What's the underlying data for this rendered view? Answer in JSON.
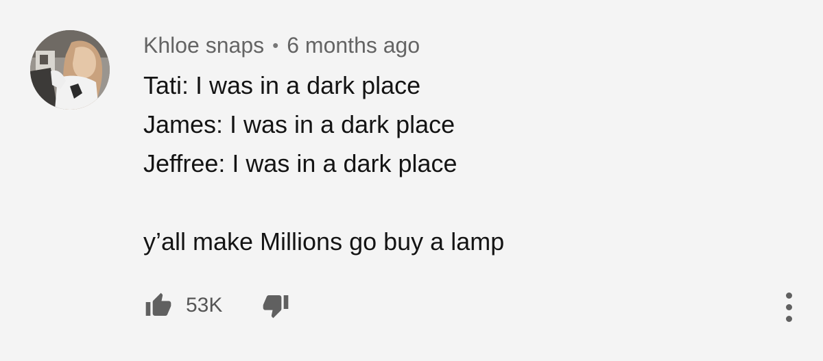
{
  "comment": {
    "author": "Khloe snaps",
    "separator": "•",
    "timestamp": "6 months ago",
    "lines": [
      "Tati: I was in a dark place",
      "James: I was in a dark place",
      "Jeffree: I was in a dark place",
      "",
      "y’all make Millions go buy a lamp"
    ],
    "like_count": "53K"
  },
  "icons": {
    "like": "thumbs-up-icon",
    "dislike": "thumbs-down-icon",
    "more": "more-vertical-icon",
    "avatar": "user-avatar-photo"
  },
  "colors": {
    "background": "#f4f4f4",
    "text": "#141414",
    "meta_text": "#646464",
    "icon": "#606060"
  }
}
